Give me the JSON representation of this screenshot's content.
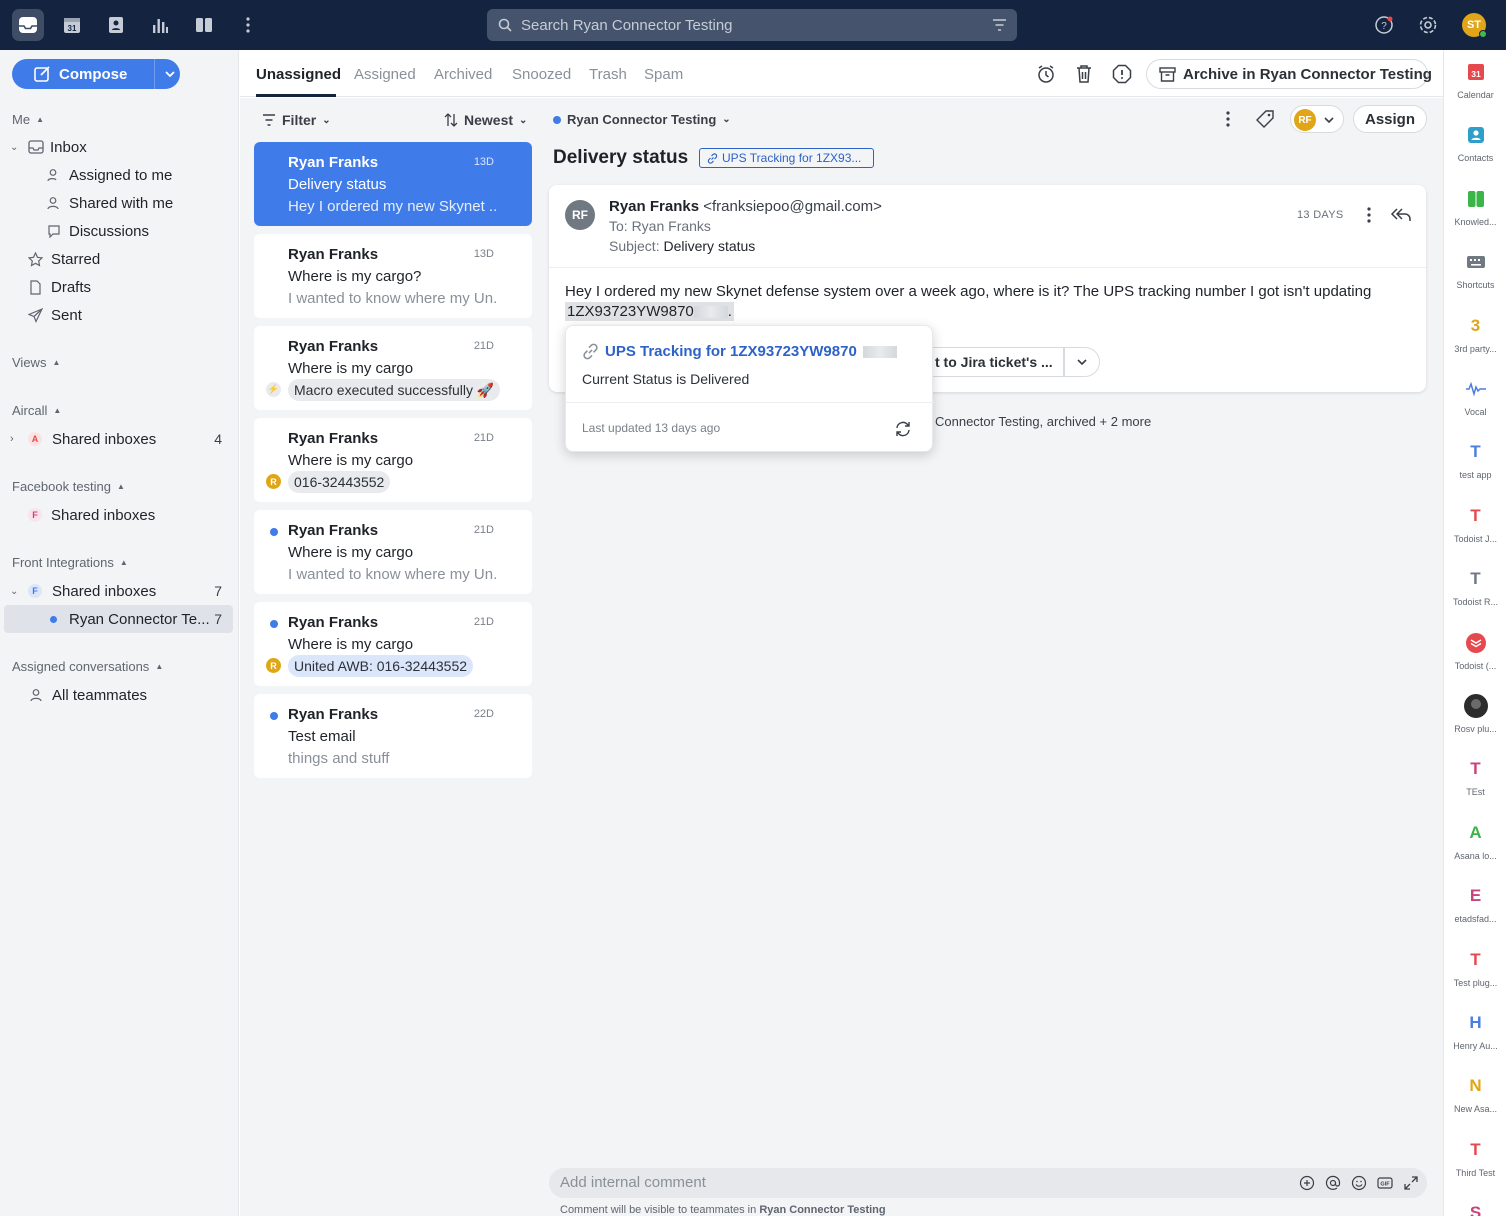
{
  "search": {
    "placeholder": "Search Ryan Connector Testing"
  },
  "user": {
    "initials": "ST"
  },
  "compose_label": "Compose",
  "sidebar": {
    "me_section": "Me",
    "inbox": "Inbox",
    "assigned_to_me": "Assigned to me",
    "shared_with_me": "Shared with me",
    "discussions": "Discussions",
    "starred": "Starred",
    "drafts": "Drafts",
    "sent": "Sent",
    "views_section": "Views",
    "aircall_section": "Aircall",
    "aircall_shared": "Shared inboxes",
    "aircall_count": "4",
    "aircall_badge": "A",
    "facebook_section": "Facebook testing",
    "facebook_shared": "Shared inboxes",
    "facebook_badge": "F",
    "front_section": "Front Integrations",
    "front_shared": "Shared inboxes",
    "front_count": "7",
    "front_badge": "F",
    "ryan_inbox": "Ryan Connector Te...",
    "ryan_count": "7",
    "assigned_section": "Assigned conversations",
    "all_teammates": "All teammates"
  },
  "tabs": [
    "Unassigned",
    "Assigned",
    "Archived",
    "Snoozed",
    "Trash",
    "Spam"
  ],
  "archive_label": "Archive in Ryan Connector Testing",
  "list": {
    "filter": "Filter",
    "sort": "Newest",
    "cards": [
      {
        "from": "Ryan Franks",
        "date": "13D",
        "subject": "Delivery status",
        "preview": "Hey I ordered my new Skynet ..."
      },
      {
        "from": "Ryan Franks",
        "date": "13D",
        "subject": "Where is my cargo?",
        "preview": "I wanted to know where my Un..."
      },
      {
        "from": "Ryan Franks",
        "date": "21D",
        "subject": "Where is my cargo",
        "chip": "Macro executed successfully 🚀"
      },
      {
        "from": "Ryan Franks",
        "date": "21D",
        "subject": "Where is my cargo",
        "chip": "016-32443552",
        "chip_badge": "R"
      },
      {
        "from": "Ryan Franks",
        "date": "21D",
        "subject": "Where is my cargo",
        "preview": "I wanted to know where my Un..."
      },
      {
        "from": "Ryan Franks",
        "date": "21D",
        "subject": "Where is my cargo",
        "chip": "United AWB: 016-32443552",
        "chip_badge": "R"
      },
      {
        "from": "Ryan Franks",
        "date": "22D",
        "subject": "Test email",
        "preview": "things and stuff"
      }
    ]
  },
  "conversation": {
    "inbox": "Ryan Connector Testing",
    "title": "Delivery status",
    "link_chip": "UPS Tracking for 1ZX93...",
    "assignee_initials": "RF",
    "assign_label": "Assign",
    "message": {
      "avatar": "RF",
      "from_name": "Ryan Franks",
      "from_email": "<franksiepoo@gmail.com>",
      "to": "To: Ryan Franks",
      "subject_label": "Subject:",
      "subject": "Delivery status",
      "age": "13 DAYS",
      "body": "Hey I ordered my new Skynet defense system over a week ago, where is it? The UPS tracking number I got isn't updating",
      "tracking": "1ZX93723YW9870"
    },
    "action_button": "t to Jira ticket's ...",
    "activity": "Connector Testing, archived + 2 more",
    "popover": {
      "title": "UPS Tracking for 1ZX93723YW9870",
      "status": "Current Status is Delivered",
      "updated": "Last updated 13 days ago"
    },
    "comment_placeholder": "Add internal comment",
    "comment_note_prefix": "Comment will be visible to teammates in",
    "comment_note_inbox": "Ryan Connector Testing"
  },
  "rail": [
    {
      "name": "Calendar",
      "glyph": "31",
      "color": "#e5484d"
    },
    {
      "name": "Contacts",
      "glyph": "",
      "color": "#2f9fc9"
    },
    {
      "name": "Knowled...",
      "glyph": "",
      "color": "#3bb54a"
    },
    {
      "name": "Shortcuts",
      "glyph": "",
      "color": "#707882"
    },
    {
      "name": "3rd party...",
      "glyph": "3",
      "color": "#e0a617"
    },
    {
      "name": "Vocal",
      "glyph": "",
      "color": "#4a7ee0"
    },
    {
      "name": "test app",
      "glyph": "T",
      "color": "#4a7ee0"
    },
    {
      "name": "Todoist J...",
      "glyph": "T",
      "color": "#e5484d"
    },
    {
      "name": "Todoist R...",
      "glyph": "T",
      "color": "#707882"
    },
    {
      "name": "Todoist (...",
      "glyph": "",
      "color": "#e5484d"
    },
    {
      "name": "Rosv plu...",
      "glyph": "",
      "color": "#2c2c2c"
    },
    {
      "name": "TEst",
      "glyph": "T",
      "color": "#c8447a"
    },
    {
      "name": "Asana lo...",
      "glyph": "A",
      "color": "#3bb54a"
    },
    {
      "name": "etadsfad...",
      "glyph": "E",
      "color": "#c8447a"
    },
    {
      "name": "Test plug...",
      "glyph": "T",
      "color": "#e5484d"
    },
    {
      "name": "Henry Au...",
      "glyph": "H",
      "color": "#4a7ee0"
    },
    {
      "name": "New Asa...",
      "glyph": "N",
      "color": "#e0a617"
    },
    {
      "name": "Third Test",
      "glyph": "T",
      "color": "#e5484d"
    },
    {
      "name": "",
      "glyph": "S",
      "color": "#c8447a"
    }
  ]
}
